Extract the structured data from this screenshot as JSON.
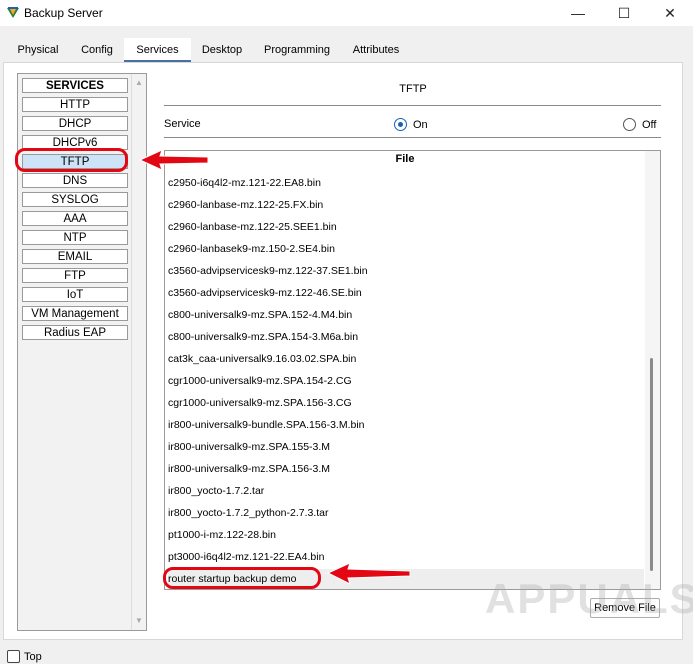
{
  "window": {
    "title": "Backup Server",
    "min_glyph": "—",
    "max_glyph": "☐",
    "close_glyph": "✕"
  },
  "tabs": [
    {
      "label": "Physical"
    },
    {
      "label": "Config"
    },
    {
      "label": "Services"
    },
    {
      "label": "Desktop"
    },
    {
      "label": "Programming"
    },
    {
      "label": "Attributes"
    }
  ],
  "active_tab": "Services",
  "sidebar": {
    "header": "SERVICES",
    "items": [
      {
        "label": "HTTP"
      },
      {
        "label": "DHCP"
      },
      {
        "label": "DHCPv6"
      },
      {
        "label": "TFTP"
      },
      {
        "label": "DNS"
      },
      {
        "label": "SYSLOG"
      },
      {
        "label": "AAA"
      },
      {
        "label": "NTP"
      },
      {
        "label": "EMAIL"
      },
      {
        "label": "FTP"
      },
      {
        "label": "IoT"
      },
      {
        "label": "VM Management"
      },
      {
        "label": "Radius EAP"
      }
    ],
    "selected": "TFTP"
  },
  "tftp": {
    "title": "TFTP",
    "service_label": "Service",
    "on_label": "On",
    "off_label": "Off",
    "service_state": "On",
    "file_header": "File",
    "files": [
      "c2950-i6q4l2-mz.121-22.EA8.bin",
      "c2960-lanbase-mz.122-25.FX.bin",
      "c2960-lanbase-mz.122-25.SEE1.bin",
      "c2960-lanbasek9-mz.150-2.SE4.bin",
      "c3560-advipservicesk9-mz.122-37.SE1.bin",
      "c3560-advipservicesk9-mz.122-46.SE.bin",
      "c800-universalk9-mz.SPA.152-4.M4.bin",
      "c800-universalk9-mz.SPA.154-3.M6a.bin",
      "cat3k_caa-universalk9.16.03.02.SPA.bin",
      "cgr1000-universalk9-mz.SPA.154-2.CG",
      "cgr1000-universalk9-mz.SPA.156-3.CG",
      "ir800-universalk9-bundle.SPA.156-3.M.bin",
      "ir800-universalk9-mz.SPA.155-3.M",
      "ir800-universalk9-mz.SPA.156-3.M",
      "ir800_yocto-1.7.2.tar",
      "ir800_yocto-1.7.2_python-2.7.3.tar",
      "pt1000-i-mz.122-28.bin",
      "pt3000-i6q4l2-mz.121-22.EA4.bin",
      "router startup backup demo"
    ],
    "selected_file": "router startup backup demo",
    "remove_button": "Remove File"
  },
  "watermark": "APPUALS",
  "bottom": {
    "top_label": "Top"
  },
  "colors": {
    "accent": "#4a6fa5",
    "selection": "#cde3f7",
    "annotation": "#e30613"
  }
}
